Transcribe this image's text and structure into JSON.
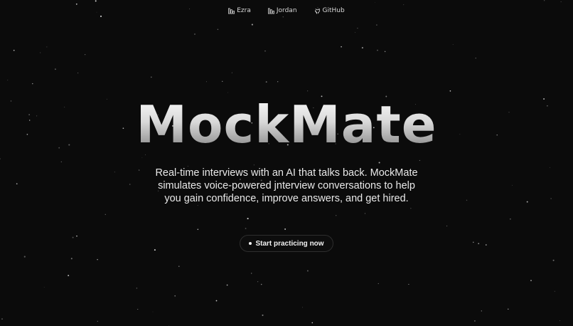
{
  "nav": {
    "items": [
      {
        "label": "Ezra",
        "icon": "bar-chart-icon"
      },
      {
        "label": "Jordan",
        "icon": "bar-chart-icon"
      },
      {
        "label": "GitHub",
        "icon": "github-icon"
      }
    ]
  },
  "hero": {
    "title": "MockMate",
    "tagline": "Real-time interviews with an AI that talks back. MockMate simulates voice-powered jnterview conversations to help you gain confidence, improve answers, and get hired.",
    "cta_label": "Start practicing now"
  },
  "colors": {
    "background": "#0b0b0b",
    "text": "#e8e8e8",
    "button_border": "#2e2e2e"
  }
}
